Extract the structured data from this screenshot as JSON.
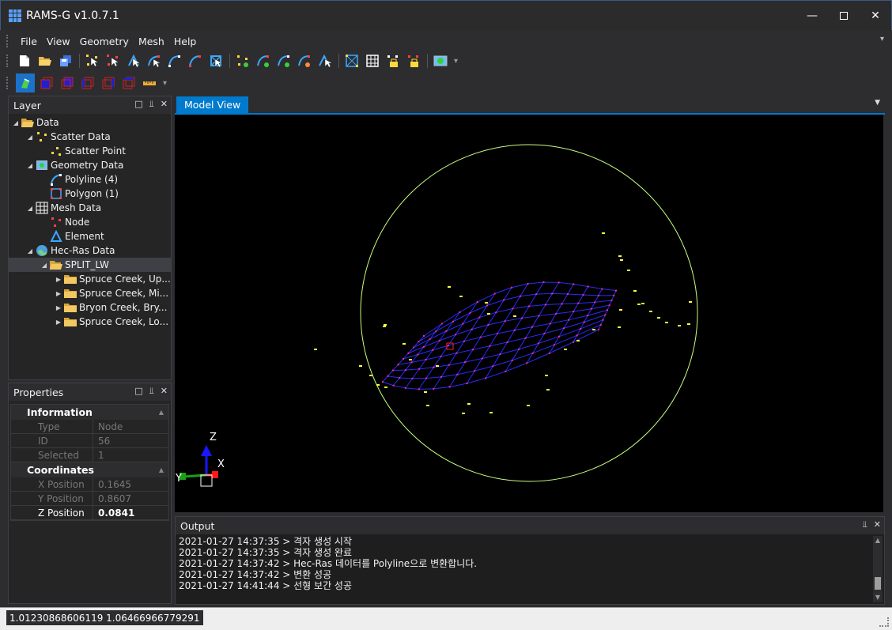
{
  "window": {
    "title": "RAMS-G v1.0.7.1"
  },
  "menu": [
    "File",
    "View",
    "Geometry",
    "Mesh",
    "Help"
  ],
  "layer_panel": {
    "title": "Layer",
    "items": [
      {
        "label": "Data",
        "indent": 0,
        "expanded": true,
        "icon": "folder-open-icon"
      },
      {
        "label": "Scatter Data",
        "indent": 1,
        "expanded": true,
        "icon": "scatter-data-icon"
      },
      {
        "label": "Scatter Point",
        "indent": 2,
        "icon": "scatter-point-icon"
      },
      {
        "label": "Geometry Data",
        "indent": 1,
        "expanded": true,
        "icon": "geometry-data-icon"
      },
      {
        "label": "Polyline (4)",
        "indent": 2,
        "icon": "polyline-icon"
      },
      {
        "label": "Polygon (1)",
        "indent": 2,
        "icon": "polygon-icon"
      },
      {
        "label": "Mesh Data",
        "indent": 1,
        "expanded": true,
        "icon": "mesh-data-icon"
      },
      {
        "label": "Node",
        "indent": 2,
        "icon": "node-icon"
      },
      {
        "label": "Element",
        "indent": 2,
        "icon": "element-icon"
      },
      {
        "label": "Hec-Ras Data",
        "indent": 1,
        "expanded": true,
        "icon": "hecras-globe-icon"
      },
      {
        "label": "SPLIT_LW",
        "indent": 2,
        "expanded": true,
        "icon": "folder-open-icon",
        "selected": true
      },
      {
        "label": "Spruce Creek, Up...",
        "indent": 3,
        "collapsed": true,
        "icon": "folder-icon"
      },
      {
        "label": "Spruce Creek, Mi...",
        "indent": 3,
        "collapsed": true,
        "icon": "folder-icon"
      },
      {
        "label": "Bryon Creek, Bry...",
        "indent": 3,
        "collapsed": true,
        "icon": "folder-icon"
      },
      {
        "label": "Spruce Creek, Lo...",
        "indent": 3,
        "collapsed": true,
        "icon": "folder-icon"
      }
    ]
  },
  "properties_panel": {
    "title": "Properties",
    "groups": [
      {
        "name": "Information",
        "rows": [
          {
            "key": "Type",
            "value": "Node"
          },
          {
            "key": "ID",
            "value": "56"
          },
          {
            "key": "Selected",
            "value": "1"
          }
        ]
      },
      {
        "name": "Coordinates",
        "rows": [
          {
            "key": "X Position",
            "value": "0.1645"
          },
          {
            "key": "Y Position",
            "value": "0.8607"
          },
          {
            "key": "Z Position",
            "value": "0.0841",
            "active": true
          }
        ]
      }
    ]
  },
  "model_view": {
    "tab": "Model View",
    "axes": {
      "z": "Z",
      "x": "X",
      "y": "Y"
    },
    "colors": {
      "sphere": "#c8ff80",
      "mesh": "#2a2aff",
      "node": "#ff2a8a",
      "scatter": "#ffff33"
    }
  },
  "output": {
    "title": "Output",
    "lines": [
      "2021-01-27 14:37:35 > 격자 생성 시작",
      "2021-01-27 14:37:35 > 격자 생성 완료",
      "2021-01-27 14:37:42 > Hec-Ras 데이터를 Polyline으로 변환합니다.",
      "2021-01-27 14:37:42 > 변환 성공",
      "2021-01-27 14:41:44 > 선형 보간 성공"
    ]
  },
  "status": {
    "coords": "1.01230868606119 1.06466966779291"
  }
}
